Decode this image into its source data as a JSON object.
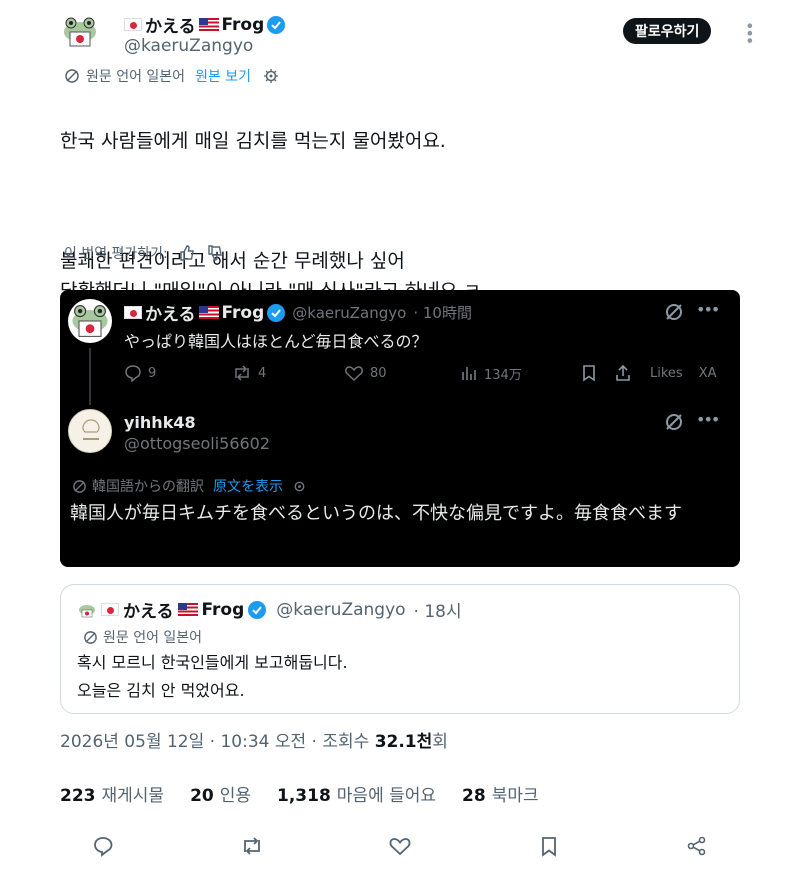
{
  "author": {
    "display_name": "かえる",
    "display_name_suffix": "Frog",
    "handle": "@kaeruZangyo"
  },
  "follow_label": "팔로우하기",
  "translation": {
    "source_label": "원문 언어 일본어",
    "view_original": "원본 보기"
  },
  "body": {
    "line1": "한국 사람들에게 매일 김치를 먹는지 물어봤어요.",
    "line2": "불쾌한 편견이라고 해서 순간 무례했나 싶어\n당황했더니 \"매일\"이 아니라 \"매 식사\"라고 하네요 ㅋ"
  },
  "rate_translation": "이 번역 평가하기:",
  "embedded": {
    "post1": {
      "display_name": "かえる",
      "display_name_suffix": "Frog",
      "handle": "@kaeruZangyo",
      "time": "· 10時間",
      "text": "やっぱり韓国人はほとんど毎日食べるの？",
      "replies": "9",
      "reposts": "4",
      "likes": "80",
      "views": "134万",
      "likes_label": "Likes",
      "xa_label": "XA"
    },
    "post2": {
      "display_name": "yihhk48",
      "handle": "@ottogseoli56602",
      "translation_label": "韓国語からの翻訳",
      "view_original": "原文を表示",
      "text": "韓国人が毎日キムチを食べるというのは、不快な偏見ですよ。毎食食べます"
    }
  },
  "quote": {
    "display_name": "かえる",
    "display_name_suffix": "Frog",
    "handle": "@kaeruZangyo",
    "time": "· 18시",
    "translation_label": "원문 언어 일본어",
    "text": "혹시 모르니 한국인들에게 보고해둡니다.\n오늘은 김치 안 먹었어요."
  },
  "timestamp": {
    "date_time": "2026년 05월 12일 · 10:34 오전 · 조회수 ",
    "views": "32.1천",
    "views_suffix": "회"
  },
  "stats": {
    "reposts_count": "223",
    "reposts_label": "재게시물",
    "quotes_count": "20",
    "quotes_label": "인용",
    "likes_count": "1,318",
    "likes_label": "마음에 들어요",
    "bookmarks_count": "28",
    "bookmarks_label": "북마크"
  },
  "colors": {
    "accent": "#1d9bf0",
    "text": "#0f1419",
    "muted": "#536471"
  },
  "icons": [
    "frog-avatar-icon",
    "verified-badge-icon",
    "translate-icon",
    "gear-icon",
    "thumbs-up-icon",
    "thumbs-down-icon",
    "reply-icon",
    "repost-icon",
    "like-icon",
    "views-icon",
    "bookmark-icon",
    "share-icon",
    "grok-icon",
    "more-icon"
  ]
}
